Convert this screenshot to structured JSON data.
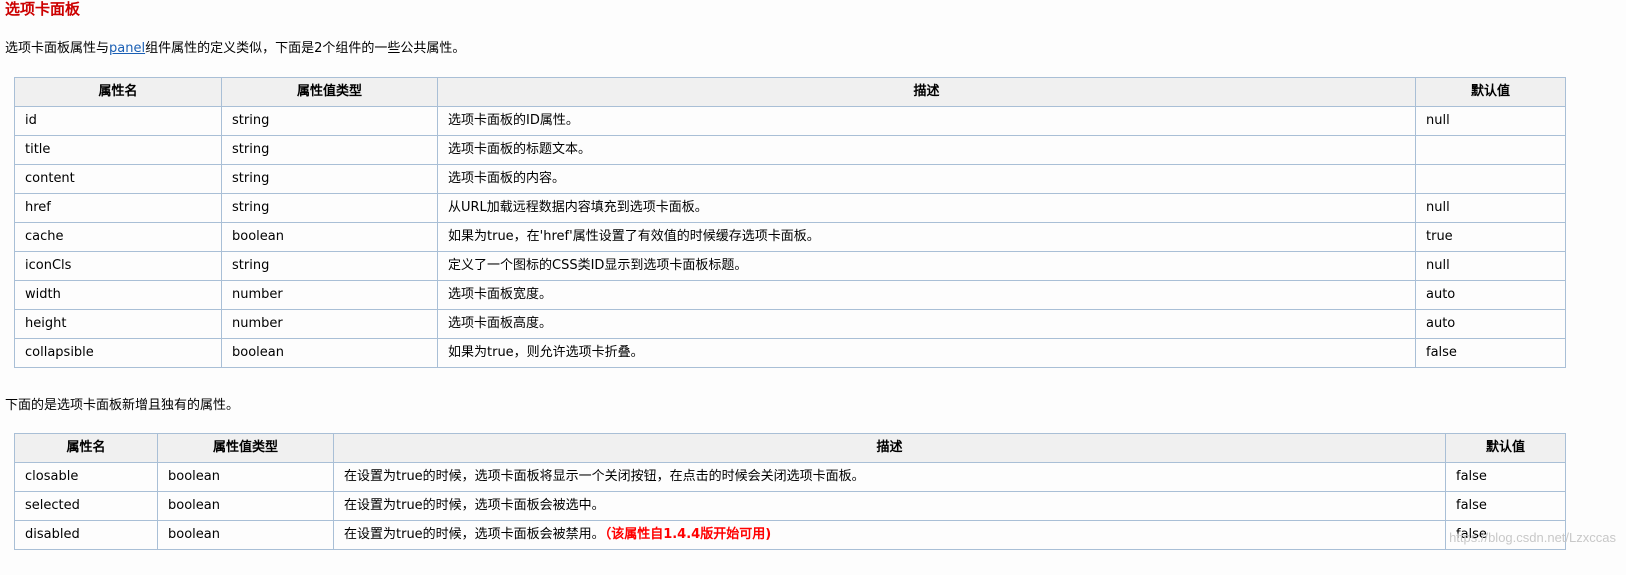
{
  "heading": "选项卡面板",
  "intro": {
    "before": "选项卡面板属性与",
    "link": "panel",
    "after": "组件属性的定义类似，下面是2个组件的一些公共属性。"
  },
  "table1": {
    "headers": [
      "属性名",
      "属性值类型",
      "描述",
      "默认值"
    ],
    "rows": [
      [
        "id",
        "string",
        "选项卡面板的ID属性。",
        "null"
      ],
      [
        "title",
        "string",
        "选项卡面板的标题文本。",
        ""
      ],
      [
        "content",
        "string",
        "选项卡面板的内容。",
        ""
      ],
      [
        "href",
        "string",
        "从URL加载远程数据内容填充到选项卡面板。",
        "null"
      ],
      [
        "cache",
        "boolean",
        "如果为true，在'href'属性设置了有效值的时候缓存选项卡面板。",
        "true"
      ],
      [
        "iconCls",
        "string",
        "定义了一个图标的CSS类ID显示到选项卡面板标题。",
        "null"
      ],
      [
        "width",
        "number",
        "选项卡面板宽度。",
        "auto"
      ],
      [
        "height",
        "number",
        "选项卡面板高度。",
        "auto"
      ],
      [
        "collapsible",
        "boolean",
        "如果为true，则允许选项卡折叠。",
        "false"
      ]
    ]
  },
  "middle_text": "下面的是选项卡面板新增且独有的属性。",
  "table2": {
    "headers": [
      "属性名",
      "属性值类型",
      "描述",
      "默认值"
    ],
    "rows": [
      [
        "closable",
        "boolean",
        "在设置为true的时候，选项卡面板将显示一个关闭按钮，在点击的时候会关闭选项卡面板。",
        "false"
      ],
      [
        "selected",
        "boolean",
        "在设置为true的时候，选项卡面板会被选中。",
        "false"
      ],
      [
        "disabled",
        "boolean",
        "在设置为true的时候，选项卡面板会被禁用。",
        "false"
      ]
    ],
    "disabled_note": "（该属性自1.4.4版开始可用)"
  },
  "watermark": "https://blog.csdn.net/Lzxccas",
  "colors": {
    "heading": "#cc0000",
    "link": "#1a5fb4",
    "note": "#ff0000",
    "border": "#a9bfd6",
    "header_bg": "#f0f0f0"
  }
}
